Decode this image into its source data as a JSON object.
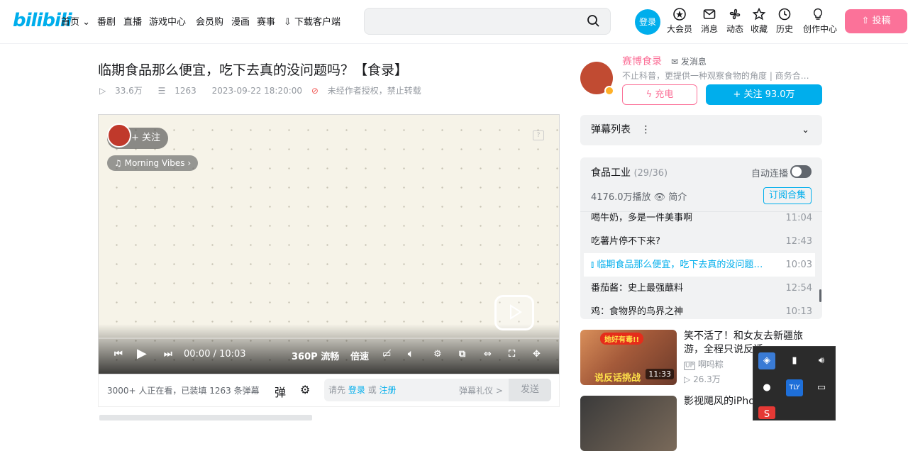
{
  "header": {
    "logo": "bilibili",
    "nav": [
      "首页",
      "番剧",
      "直播",
      "游戏中心",
      "会员购",
      "漫画",
      "赛事",
      "下载客户端"
    ],
    "search_placeholder": "",
    "login": "登录",
    "icons": [
      {
        "label": "大会员",
        "icon": "vip-icon"
      },
      {
        "label": "消息",
        "icon": "mail-icon"
      },
      {
        "label": "动态",
        "icon": "fan-icon"
      },
      {
        "label": "收藏",
        "icon": "star-icon"
      },
      {
        "label": "历史",
        "icon": "clock-icon"
      },
      {
        "label": "创作中心",
        "icon": "bulb-icon"
      }
    ],
    "upload": "投稿"
  },
  "video": {
    "title": "临期食品那么便宜，吃下去真的没问题吗？【食录】",
    "views": "33.6万",
    "danmaku_count": "1263",
    "datetime": "2023-09-22 18:20:00",
    "copyright": "未经作者授权，禁止转载"
  },
  "player": {
    "follow": "+ 关注",
    "music": "Morning Vibes",
    "time": "00:00 / 10:03",
    "quality": "360P 流畅",
    "speed": "倍速",
    "controls": [
      "prev-icon",
      "play-icon",
      "next-icon",
      "danmaku-off-icon",
      "volume-icon",
      "settings-icon",
      "pip-icon",
      "widescreen-icon",
      "fullscreen-icon",
      "fan-icon"
    ]
  },
  "danmaku_bar": {
    "watching": "3000+ 人正在看，已装填 1263 条弹幕",
    "input_prefix": "请先",
    "login": "登录",
    "or": "或",
    "register": "注册",
    "etiquette": "弹幕礼仪 >",
    "send": "发送"
  },
  "uploader": {
    "name": "赛博食录",
    "message": "发消息",
    "desc": "不止科普，更提供一种观察食物的角度 | 商务合…",
    "charge": "充电",
    "follow": "+ 关注 93.0万"
  },
  "danmaku_list": {
    "label": "弹幕列表"
  },
  "collection": {
    "title": "食品工业",
    "count": "(29/36)",
    "autoplay": "自动连播",
    "plays": "4176.0万播放",
    "intro": "简介",
    "subscribe": "订阅合集",
    "episodes": [
      {
        "title": "喝牛奶，多是一件美事啊",
        "duration": "11:04",
        "active": false
      },
      {
        "title": "吃薯片停不下来?",
        "duration": "12:43",
        "active": false
      },
      {
        "title": "临期食品那么便宜，吃下去真的没问题吗？",
        "duration": "10:03",
        "active": true
      },
      {
        "title": "番茄酱：史上最强蘸料",
        "duration": "12:54",
        "active": false
      },
      {
        "title": "鸡：食物界的鸟界之神",
        "duration": "10:13",
        "active": false
      }
    ]
  },
  "recommend": [
    {
      "title": "笑不活了！和女友去新疆旅游，全程只说反话",
      "up": "啊吗粽",
      "views": "26.3万",
      "duration": "11:33",
      "banner": "她好有毒!!",
      "caption": "说反话挑战"
    },
    {
      "title": "影视飓风的iPhone拍的。。。"
    }
  ],
  "colors": {
    "accent": "#00aeec",
    "pink": "#fb7299"
  }
}
